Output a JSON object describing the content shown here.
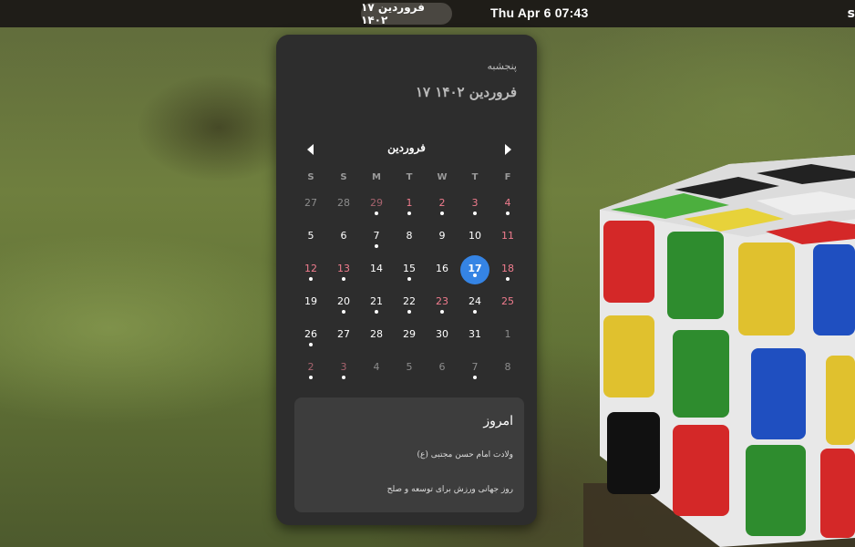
{
  "topbar": {
    "date_pill": "۱۷ فروردین ۱۴۰۲",
    "clock": "Thu Apr 6  07:43",
    "status_icon": "s"
  },
  "popup": {
    "weekday": "پنجشبه",
    "full_date": "۱۷ فروردین ۱۴۰۲",
    "month_name": "فروردین",
    "weekday_headers": [
      "S",
      "S",
      "M",
      "T",
      "W",
      "T",
      "F"
    ],
    "weeks": [
      [
        {
          "d": "27",
          "dim": true
        },
        {
          "d": "28",
          "dim": true
        },
        {
          "d": "29",
          "dim": true,
          "hol": true,
          "ev": true
        },
        {
          "d": "1",
          "hol": true,
          "ev": true
        },
        {
          "d": "2",
          "hol": true,
          "ev": true
        },
        {
          "d": "3",
          "hol": true,
          "ev": true
        },
        {
          "d": "4",
          "hol": true,
          "ev": true
        }
      ],
      [
        {
          "d": "5"
        },
        {
          "d": "6"
        },
        {
          "d": "7",
          "ev": true
        },
        {
          "d": "8"
        },
        {
          "d": "9"
        },
        {
          "d": "10"
        },
        {
          "d": "11",
          "hol": true
        }
      ],
      [
        {
          "d": "12",
          "hol": true,
          "ev": true
        },
        {
          "d": "13",
          "hol": true,
          "ev": true
        },
        {
          "d": "14"
        },
        {
          "d": "15",
          "ev": true
        },
        {
          "d": "16"
        },
        {
          "d": "17",
          "today": true,
          "ev": true
        },
        {
          "d": "18",
          "hol": true,
          "ev": true
        }
      ],
      [
        {
          "d": "19"
        },
        {
          "d": "20",
          "ev": true
        },
        {
          "d": "21",
          "ev": true
        },
        {
          "d": "22",
          "ev": true
        },
        {
          "d": "23",
          "hol": true,
          "ev": true
        },
        {
          "d": "24",
          "ev": true
        },
        {
          "d": "25",
          "hol": true
        }
      ],
      [
        {
          "d": "26",
          "ev": true
        },
        {
          "d": "27"
        },
        {
          "d": "28"
        },
        {
          "d": "29"
        },
        {
          "d": "30"
        },
        {
          "d": "31"
        },
        {
          "d": "1",
          "dim": true
        }
      ],
      [
        {
          "d": "2",
          "dim": true,
          "hol": true,
          "ev": true
        },
        {
          "d": "3",
          "dim": true,
          "hol": true,
          "ev": true
        },
        {
          "d": "4",
          "dim": true
        },
        {
          "d": "5",
          "dim": true
        },
        {
          "d": "6",
          "dim": true
        },
        {
          "d": "7",
          "dim": true,
          "ev": true
        },
        {
          "d": "8",
          "dim": true
        }
      ]
    ],
    "events": {
      "title": "امروز",
      "items": [
        "ولادت امام حسن مجتبی (ع)",
        "روز جهانی ورزش برای توسعه و صلح"
      ]
    }
  },
  "colors": {
    "accent": "#3584e4",
    "holiday": "#f07c8e",
    "popup_bg": "#2d2d2d",
    "topbar_bg": "#1f1d18"
  },
  "icons": {
    "prev": "pan-start-icon",
    "next": "pan-end-icon"
  }
}
